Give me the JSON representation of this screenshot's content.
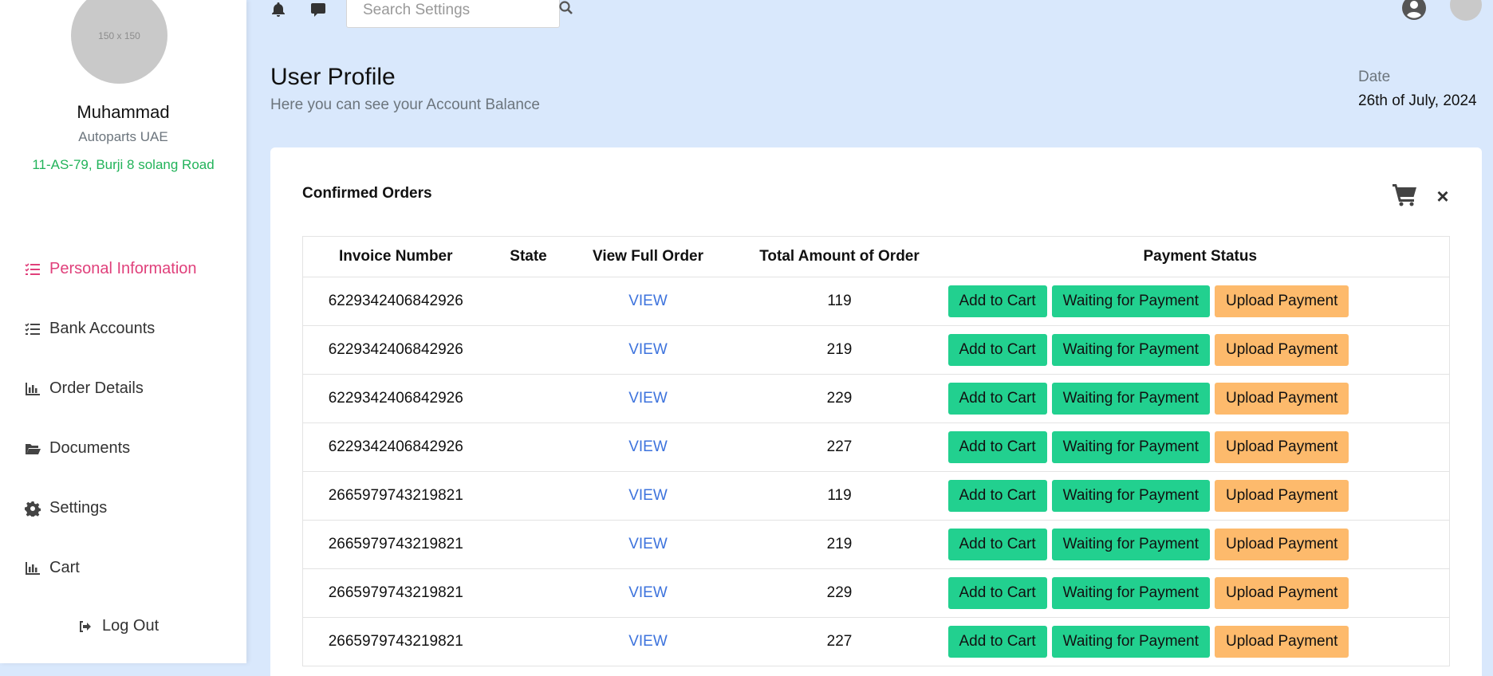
{
  "colors": {
    "accent": "#e0407b",
    "green": "#22d08f",
    "orange": "#fdba6c",
    "link": "#3d73dd",
    "background": "#d9e8fc"
  },
  "sidebar": {
    "avatar_text": "150 x 150",
    "name": "Muhammad",
    "company": "Autoparts UAE",
    "address": "11-AS-79, Burji 8 solang Road",
    "items": [
      {
        "label": "Personal Information",
        "icon": "list-check-icon"
      },
      {
        "label": "Bank Accounts",
        "icon": "list-check-icon"
      },
      {
        "label": "Order Details",
        "icon": "chart-bar-icon"
      },
      {
        "label": "Documents",
        "icon": "folder-open-icon"
      },
      {
        "label": "Settings",
        "icon": "gear-icon"
      },
      {
        "label": "Cart",
        "icon": "chart-bar-icon"
      }
    ],
    "logout_label": "Log Out"
  },
  "topbar": {
    "search_placeholder": "Search Settings"
  },
  "header": {
    "title": "User Profile",
    "subtitle": "Here you can see your Account Balance",
    "date_label": "Date",
    "date_value": "26th of July, 2024"
  },
  "card": {
    "title": "Confirmed Orders",
    "close_symbol": "×",
    "columns": [
      "Invoice Number",
      "State",
      "View Full Order",
      "Total Amount of Order",
      "Payment Status"
    ],
    "rows": [
      {
        "invoice": "6229342406842926",
        "state": "",
        "view": "VIEW",
        "total": "119",
        "btn1": "Add to Cart",
        "btn2": "Waiting for Payment",
        "btn3": "Upload Payment"
      },
      {
        "invoice": "6229342406842926",
        "state": "",
        "view": "VIEW",
        "total": "219",
        "btn1": "Add to Cart",
        "btn2": "Waiting for Payment",
        "btn3": "Upload Payment"
      },
      {
        "invoice": "6229342406842926",
        "state": "",
        "view": "VIEW",
        "total": "229",
        "btn1": "Add to Cart",
        "btn2": "Waiting for Payment",
        "btn3": "Upload Payment"
      },
      {
        "invoice": "6229342406842926",
        "state": "",
        "view": "VIEW",
        "total": "227",
        "btn1": "Add to Cart",
        "btn2": "Waiting for Payment",
        "btn3": "Upload Payment"
      },
      {
        "invoice": "2665979743219821",
        "state": "",
        "view": "VIEW",
        "total": "119",
        "btn1": "Add to Cart",
        "btn2": "Waiting for Payment",
        "btn3": "Upload Payment"
      },
      {
        "invoice": "2665979743219821",
        "state": "",
        "view": "VIEW",
        "total": "219",
        "btn1": "Add to Cart",
        "btn2": "Waiting for Payment",
        "btn3": "Upload Payment"
      },
      {
        "invoice": "2665979743219821",
        "state": "",
        "view": "VIEW",
        "total": "229",
        "btn1": "Add to Cart",
        "btn2": "Waiting for Payment",
        "btn3": "Upload Payment"
      },
      {
        "invoice": "2665979743219821",
        "state": "",
        "view": "VIEW",
        "total": "227",
        "btn1": "Add to Cart",
        "btn2": "Waiting for Payment",
        "btn3": "Upload Payment"
      }
    ]
  }
}
